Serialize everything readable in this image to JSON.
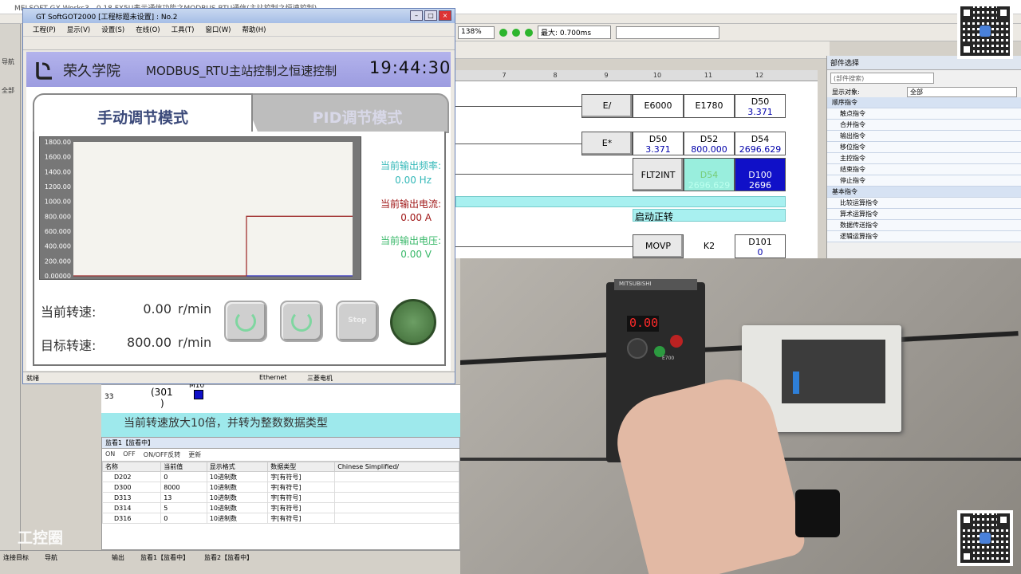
{
  "gx": {
    "title": "MELSOFT GX Works3 - 0.18 FX5U表示通信功能之MODBUS RTU通信(主站控制之恒速控制)",
    "zoom": "138%",
    "scan_time": "最大: 0.700ms",
    "col_numbers": [
      "7",
      "8",
      "9",
      "10",
      "11",
      "12"
    ],
    "rungs": {
      "r1": {
        "cmd": "E/",
        "a": "E6000",
        "b": "E1780",
        "c": "D50",
        "c_val": "3.371"
      },
      "r2": {
        "cmd": "E*",
        "a": "D50",
        "a_val": "3.371",
        "b": "D52",
        "b_val": "800.000",
        "c": "D54",
        "c_val": "2696.629"
      },
      "r3": {
        "cmd": "FLT2INT",
        "a": "D54",
        "a_val": "2696.629",
        "c": "D100",
        "c_val": "2696"
      },
      "r4": {
        "coil": "启动正转"
      },
      "r5": {
        "cmd": "MOVP",
        "a": "K2",
        "c": "D101",
        "c_val": "0"
      }
    },
    "rung33": {
      "number": "33",
      "operand": "(301",
      "operand2": ")",
      "label": "M10"
    },
    "comment": "当前转速放大10倍，并转为整数数据类型"
  },
  "parts": {
    "title": "部件选择",
    "search_placeholder": "(部件搜索)",
    "display_label": "显示对象:",
    "display_value": "全部",
    "rows": [
      {
        "label": "顺序指令",
        "kind": "cat"
      },
      {
        "label": "触点指令",
        "kind": "item"
      },
      {
        "label": "合并指令",
        "kind": "item"
      },
      {
        "label": "输出指令",
        "kind": "item"
      },
      {
        "label": "移位指令",
        "kind": "item"
      },
      {
        "label": "主控指令",
        "kind": "item"
      },
      {
        "label": "结束指令",
        "kind": "item"
      },
      {
        "label": "停止指令",
        "kind": "item"
      },
      {
        "label": "基本指令",
        "kind": "cat"
      },
      {
        "label": "比较运算指令",
        "kind": "item"
      },
      {
        "label": "算术运算指令",
        "kind": "item"
      },
      {
        "label": "数据传送指令",
        "kind": "item"
      },
      {
        "label": "逻辑运算指令",
        "kind": "item"
      }
    ]
  },
  "monitor": {
    "caption": "监看1【监看中】",
    "buttons": [
      "ON",
      "OFF",
      "ON/OFF反转",
      "更新"
    ],
    "columns": [
      "名称",
      "当前值",
      "显示格式",
      "数据类型",
      "Chinese Simplified/"
    ],
    "rows": [
      [
        "D202",
        "0",
        "10进制数",
        "字[有符号]",
        ""
      ],
      [
        "D300",
        "8000",
        "10进制数",
        "字[有符号]",
        ""
      ],
      [
        "D313",
        "13",
        "10进制数",
        "字[有符号]",
        ""
      ],
      [
        "D314",
        "5",
        "10进制数",
        "字[有符号]",
        ""
      ],
      [
        "D316",
        "0",
        "10进制数",
        "字[有符号]",
        ""
      ]
    ]
  },
  "statusbar": {
    "connect": "连接目标",
    "nav": "导航",
    "output": "输出",
    "watch1": "监看1【监看中】",
    "watch2": "监看2【监看中】"
  },
  "left_nav": {
    "title": "导航",
    "all": "全部"
  },
  "got": {
    "title": "GT SoftGOT2000 [工程标题未设置] : No.2",
    "menu": [
      "工程(P)",
      "显示(V)",
      "设置(S)",
      "在线(O)",
      "工具(T)",
      "窗口(W)",
      "帮助(H)"
    ],
    "status_left": "就绪",
    "status_mid": "Ethernet",
    "status_right": "三菱电机"
  },
  "hmi": {
    "brand": "荣久学院",
    "subject": "MODBUS_RTU主站控制之恒速控制",
    "clock": "19:44:30",
    "tab_manual": "手动调节模式",
    "tab_pid": "PID调节模式",
    "freq_label": "当前输出频率:",
    "freq_value": "0.00 Hz",
    "current_label": "当前输出电流:",
    "current_value": "0.00 A",
    "voltage_label": "当前输出电压:",
    "voltage_value": "0.00 V",
    "cur_speed_label": "当前转速:",
    "cur_speed_value": "0.00",
    "target_speed_label": "目标转速:",
    "target_speed_value": "800.00",
    "speed_unit": "r/min",
    "stop_label": "Stop",
    "colors": {
      "freq": "#33b8b8",
      "current": "#a01818",
      "voltage": "#3ab86a",
      "trend": "#a03030"
    }
  },
  "chart_data": {
    "type": "line",
    "y_ticks": [
      "1800.00",
      "1600.00",
      "1400.00",
      "1200.00",
      "1000.00",
      "800.000",
      "600.000",
      "400.000",
      "200.000",
      "0.00000"
    ],
    "ylim": [
      0,
      1800
    ],
    "series": [
      {
        "points": [
          [
            0.0,
            0
          ],
          [
            0.62,
            0
          ],
          [
            0.62,
            800
          ],
          [
            1.0,
            800
          ]
        ],
        "color": "#a03030"
      },
      {
        "points": [
          [
            0.62,
            0
          ],
          [
            1.0,
            0
          ]
        ],
        "color": "#3030c0"
      }
    ]
  },
  "camera": {
    "display": "0.00",
    "brand": "MITSUBISHI",
    "model": "E700"
  },
  "watermark": "工控圈"
}
